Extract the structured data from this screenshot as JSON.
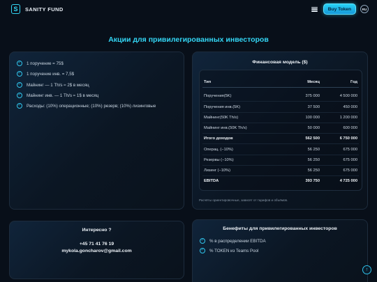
{
  "header": {
    "brand": "SANITY FUND",
    "logo_letter": "S",
    "buy_label": "Buy Token",
    "lang": "RU"
  },
  "page_title": "Акции для привилегированных инвесторов",
  "facts": [
    "1 поручение = 75$",
    "1 поручение инв. = 7,5$",
    "Майнинг — 1 Th/s ≈ 2$ в месяц",
    "Майнинг инв. — 1 Th/s ≈ 1$ в месяц",
    "Расходы: (10%) операционные; (10%) резерв; (10%) лизинговые"
  ],
  "model": {
    "title": "Финансовая модель ($)",
    "columns": [
      "Тип",
      "Месяц",
      "Год"
    ],
    "rows": [
      [
        "Поручения(5K)",
        "375 000",
        "4 500 000"
      ],
      [
        "Поручения инв.(5K)",
        "37 500",
        "450 000"
      ],
      [
        "Майнинг(50K Th/s)",
        "100 000",
        "1 200 000"
      ],
      [
        "Майнинг инв.(50K Th/s)",
        "50 000",
        "600 000"
      ],
      [
        "Итого доходов",
        "562 500",
        "6 750 000"
      ],
      [
        "Операц. (−10%)",
        "56 250",
        "675 000"
      ],
      [
        "Резервы (−10%)",
        "56 250",
        "675 000"
      ],
      [
        "Лизинг (−10%)",
        "56 250",
        "675 000"
      ],
      [
        "EBITDA",
        "393 750",
        "4 725 000"
      ]
    ],
    "note": "Расчёты ориентировочные, зависят от тарифов и объёмов."
  },
  "contact": {
    "title": "Интересно ?",
    "phone": "+45 71 41 76 19",
    "email": "mykola.goncharov@gmail.com"
  },
  "benefits": {
    "title": "Бенефиты для привилегированных инвесторов",
    "items": [
      "% в распределении EBITDA",
      "% TOKEN из Teams Pool"
    ]
  },
  "colors": {
    "accent": "#33d6f5",
    "background": "#080f19"
  },
  "icons": {
    "check": "check-circle-icon",
    "scroll_top": "arrow-up-icon",
    "menu": "menu-icon"
  }
}
